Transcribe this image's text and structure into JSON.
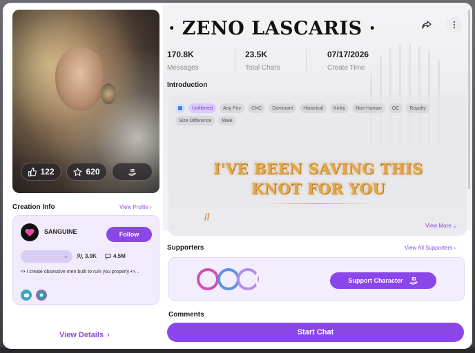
{
  "character": {
    "name": "· ZENO LASCARIS ·",
    "likes": "122",
    "favorites": "620"
  },
  "stats": [
    {
      "value": "170.8K",
      "label": "Messages"
    },
    {
      "value": "23.5K",
      "label": "Total Chars"
    },
    {
      "value": "07/17/2026",
      "label": "Create Time"
    }
  ],
  "creation_info": {
    "heading": "Creation Info",
    "view_profile": "View Profile",
    "creator_name": "SANGUINE",
    "follow_label": "Follow",
    "followers": "3.0K",
    "chats": "4.5M",
    "bio": "<• I create obsessive men built to ruin you properly •>..."
  },
  "view_details": "View Details",
  "introduction": {
    "heading": "Introduction",
    "tags": [
      "Unfiltered",
      "Any Pov",
      "CNC",
      "Dominant",
      "Historical",
      "Kinky",
      "Non-Human",
      "OC",
      "Royalty",
      "Size Difference",
      "Male"
    ],
    "banner": "I'VE BEEN SAVING THIS KNOT FOR YOU",
    "view_more": "View More"
  },
  "supporters": {
    "heading": "Supporters",
    "view_all": "View All Supporters",
    "support_label": "Support Character"
  },
  "comments_heading": "Comments",
  "start_chat": "Start Chat",
  "colors": {
    "accent": "#8b46ea",
    "banner_gold": "#e2a64b"
  }
}
